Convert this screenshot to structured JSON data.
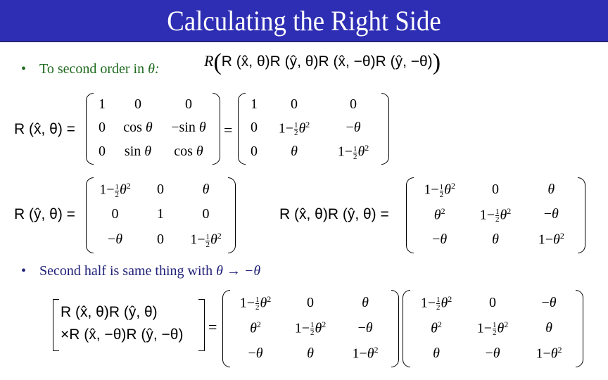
{
  "slide": {
    "title": "Calculating the Right Side",
    "title_bar_color": "#2e2eb4",
    "bullets": [
      {
        "text": "To second order in ",
        "math": "θ:",
        "color": "#1e6a1e"
      },
      {
        "text": "Second half is same thing with ",
        "math": "θ → −θ",
        "color": "#22227a"
      }
    ],
    "expressions": {
      "top_expression": {
        "prefix": "R",
        "factors": [
          "R (x̂, θ)",
          "R (ŷ, θ)",
          "R (x̂, −θ)",
          "R (ŷ, −θ)"
        ]
      },
      "rx_label": "R (x̂, θ) =",
      "rx_exact": [
        [
          "1",
          "0",
          "0"
        ],
        [
          "0",
          "cos θ",
          "−sin θ"
        ],
        [
          "0",
          "sin θ",
          "cos θ"
        ]
      ],
      "rx_approx": [
        [
          "1",
          "0",
          "0"
        ],
        [
          "0",
          "1−½θ²",
          "−θ"
        ],
        [
          "0",
          "θ",
          "1−½θ²"
        ]
      ],
      "ry_label": "R (ŷ, θ) =",
      "ry_approx": [
        [
          "1−½θ²",
          "0",
          "θ"
        ],
        [
          "0",
          "1",
          "0"
        ],
        [
          "−θ",
          "0",
          "1−½θ²"
        ]
      ],
      "rxry_label": "R (x̂, θ)R (ŷ, θ) =",
      "rxry": [
        [
          "1−½θ²",
          "0",
          "θ"
        ],
        [
          "θ²",
          "1−½θ²",
          "−θ"
        ],
        [
          "−θ",
          "θ",
          "1−θ²"
        ]
      ],
      "full_label_line1": "R (x̂, θ)R (ŷ, θ)",
      "full_label_line2": "×R (x̂, −θ)R (ŷ, −θ)",
      "full_m1": [
        [
          "1−½θ²",
          "0",
          "θ"
        ],
        [
          "θ²",
          "1−½θ²",
          "−θ"
        ],
        [
          "−θ",
          "θ",
          "1−θ²"
        ]
      ],
      "full_m2": [
        [
          "1−½θ²",
          "0",
          "−θ"
        ],
        [
          "θ²",
          "1−½θ²",
          "θ"
        ],
        [
          "θ",
          "−θ",
          "1−θ²"
        ]
      ],
      "equals": "="
    }
  }
}
